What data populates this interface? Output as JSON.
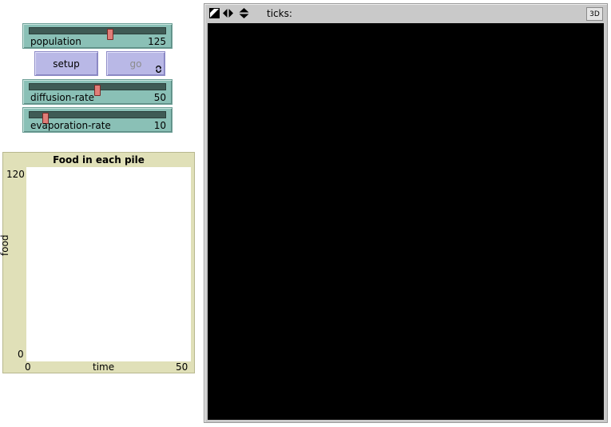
{
  "sliders": {
    "population": {
      "label": "population",
      "value": "125",
      "fraction": 0.6
    },
    "diffusion": {
      "label": "diffusion-rate",
      "value": "50",
      "fraction": 0.5
    },
    "evaporation": {
      "label": "evaporation-rate",
      "value": "10",
      "fraction": 0.1
    }
  },
  "buttons": {
    "setup": "setup",
    "go": "go"
  },
  "plot": {
    "title": "Food in each pile",
    "ylabel": "food",
    "xlabel": "time",
    "ymax": "120",
    "ymin": "0",
    "xmin": "0",
    "xmax": "50"
  },
  "view": {
    "ticks_label": "ticks:",
    "btn_3d": "3D"
  },
  "icons": {
    "view_size": "resize-icon",
    "arrows_horizontal": "horizontal-arrows-icon",
    "arrows_vertical": "vertical-arrows-icon",
    "forever": "forever-icon"
  }
}
